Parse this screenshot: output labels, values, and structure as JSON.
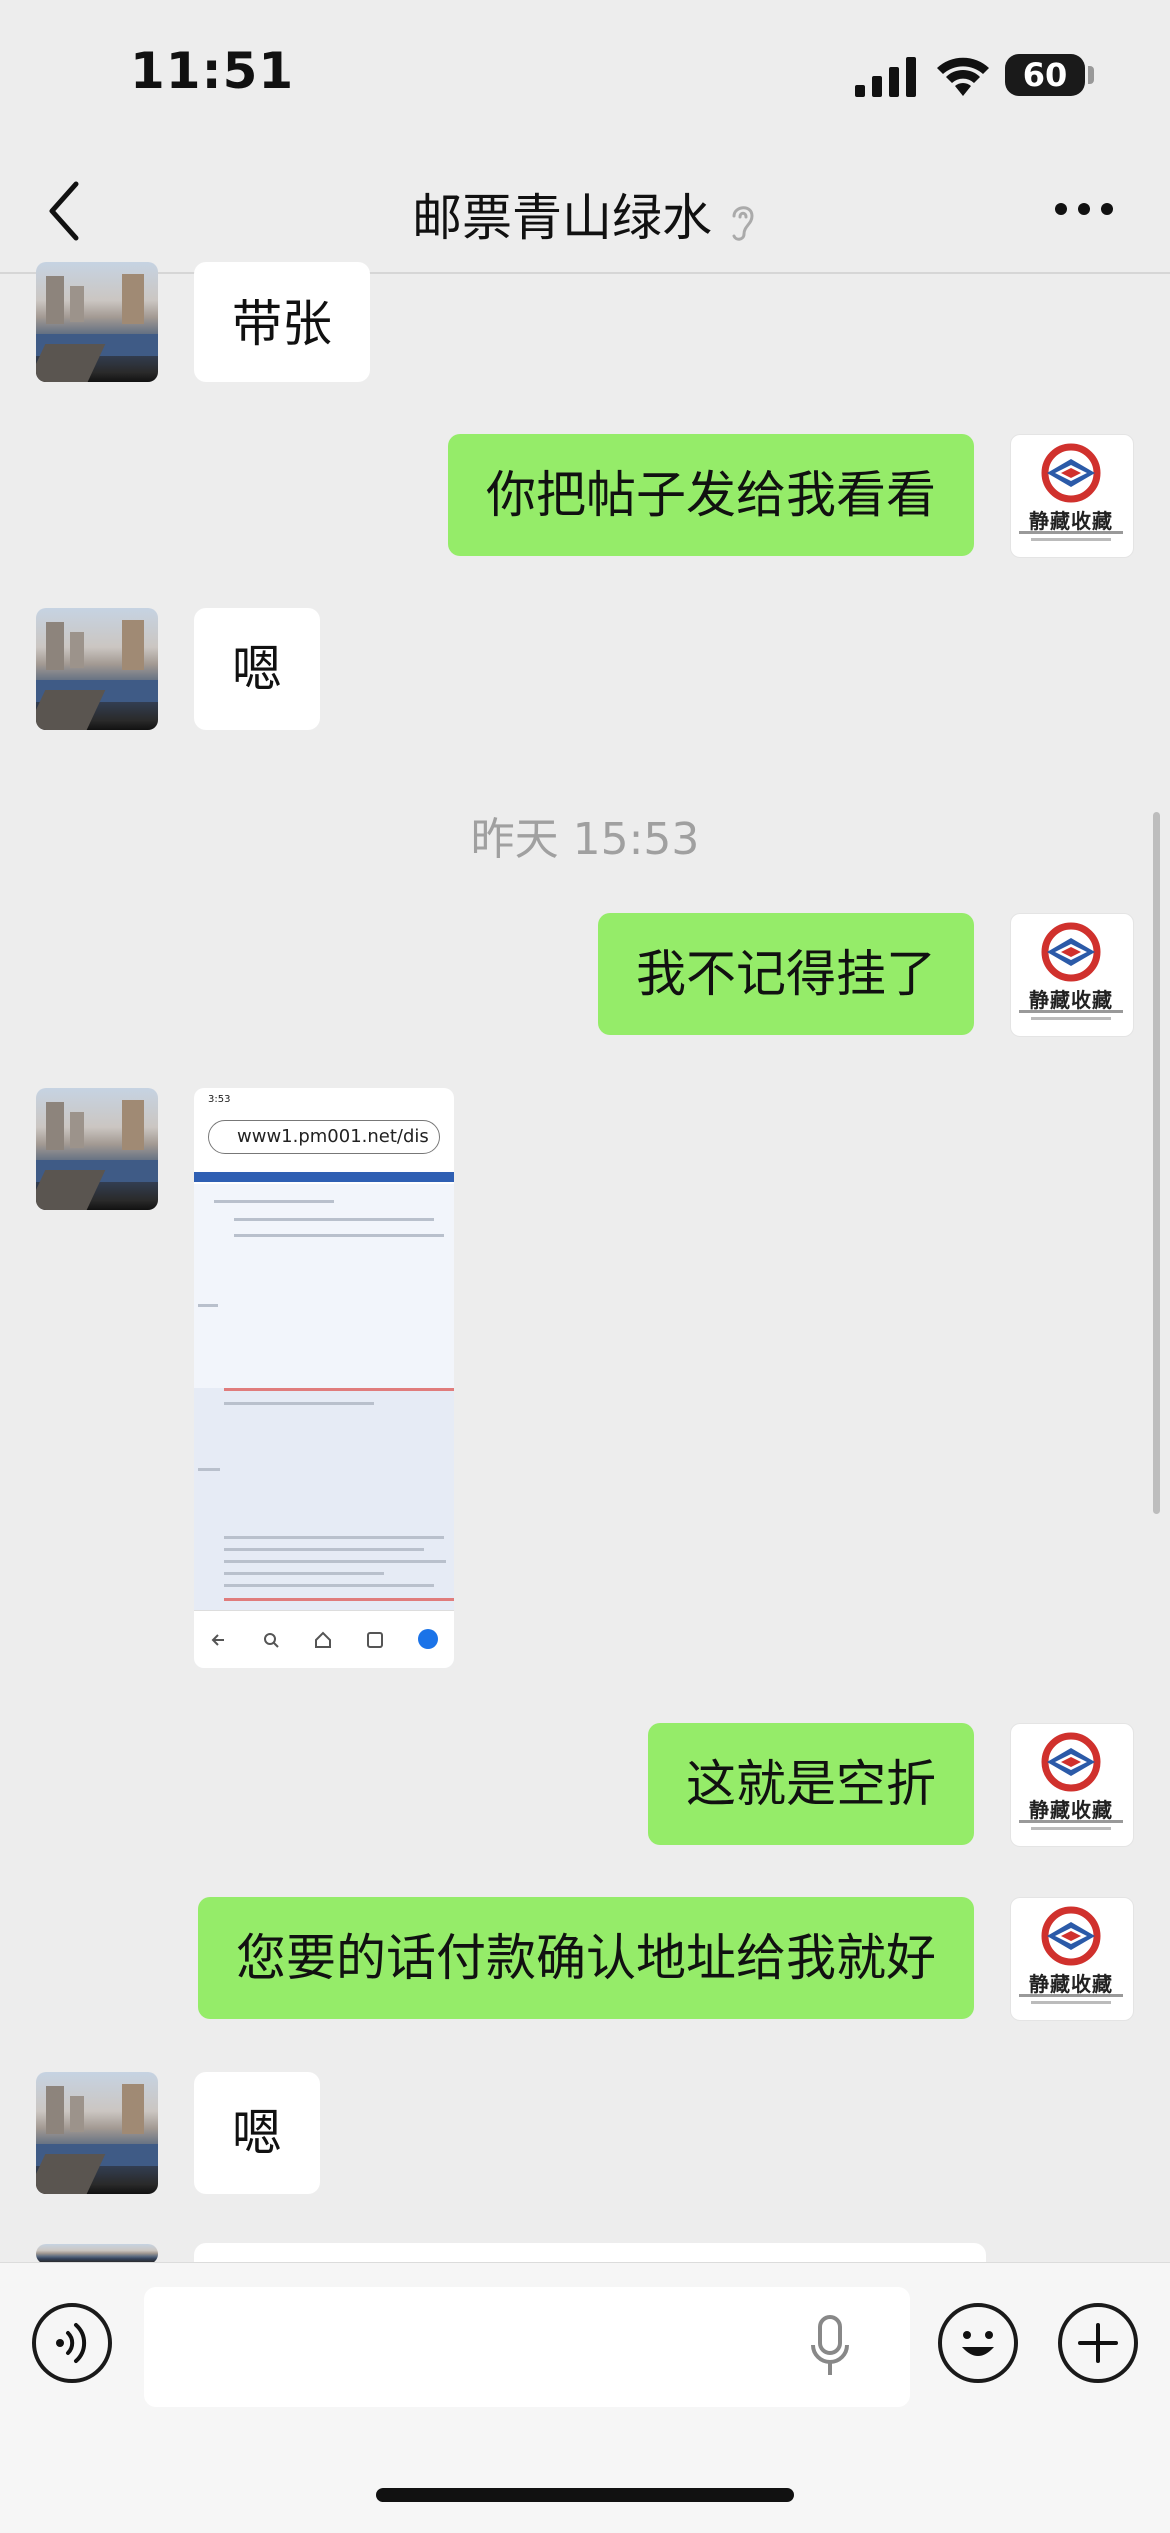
{
  "status_bar": {
    "time": "11:51",
    "battery": "60"
  },
  "header": {
    "title": "邮票青山绿水"
  },
  "timestamp": "昨天 15:53",
  "messages": [
    {
      "side": "in",
      "text": "带张"
    },
    {
      "side": "out",
      "text": "你把帖子发给我看看"
    },
    {
      "side": "in",
      "text": "嗯"
    },
    {
      "side": "out",
      "text": "我不记得挂了"
    },
    {
      "side": "in",
      "type": "image"
    },
    {
      "side": "out",
      "text": "这就是空折"
    },
    {
      "side": "out",
      "text": "您要的话付款确认地址给我就好"
    },
    {
      "side": "in",
      "text": "嗯"
    }
  ],
  "image_message": {
    "status_time": "3:53",
    "url": "www1.pm001.net/dis"
  },
  "self_avatar": {
    "logo_text": "静藏收藏"
  },
  "colors": {
    "bubble_out": "#95ec69",
    "bubble_in": "#ffffff",
    "background": "#ededed"
  },
  "icons": [
    "back-icon",
    "ear-icon",
    "more-icon",
    "voice-icon",
    "microphone-icon",
    "emoji-icon",
    "plus-icon"
  ]
}
